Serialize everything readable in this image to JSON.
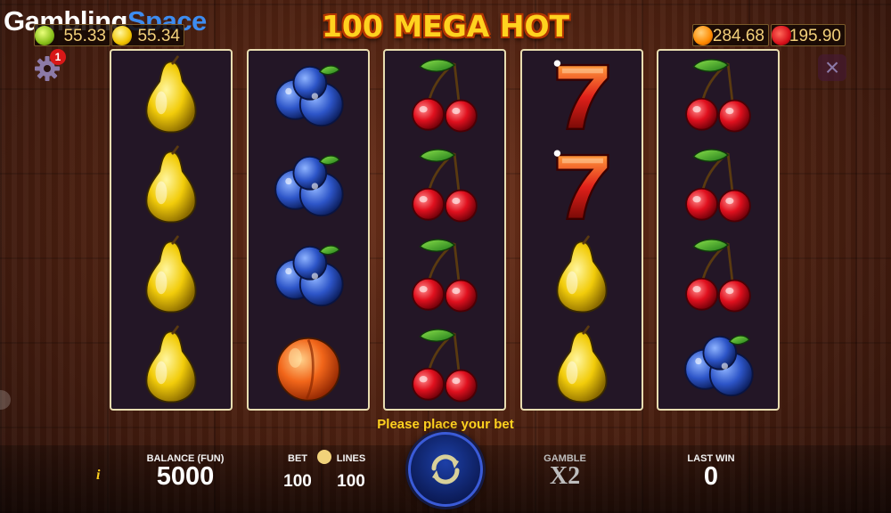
{
  "brand": {
    "word1": "Gambling",
    "word2": "Space"
  },
  "game": {
    "title": "100 MEGA HOT"
  },
  "jackpots": [
    {
      "icon": "lime-icon",
      "value": "55.33"
    },
    {
      "icon": "lemon-icon",
      "value": "55.34"
    },
    {
      "icon": "orange-icon",
      "value": "284.68"
    },
    {
      "icon": "strawberry-icon",
      "value": "195.90"
    }
  ],
  "settings": {
    "notification_count": "1"
  },
  "reels": [
    [
      "pear",
      "pear",
      "pear",
      "pear"
    ],
    [
      "blueberry",
      "blueberry",
      "blueberry",
      "peach"
    ],
    [
      "cherry",
      "cherry",
      "cherry",
      "cherry"
    ],
    [
      "seven",
      "seven",
      "pear",
      "pear"
    ],
    [
      "cherry",
      "cherry",
      "cherry",
      "blueberry"
    ]
  ],
  "status": {
    "prompt": "Please place your bet"
  },
  "controls": {
    "info_label": "i",
    "balance_label": "BALANCE (FUN)",
    "balance_value": "5000",
    "bet_label": "BET",
    "bet_value": "100",
    "lines_label": "LINES",
    "lines_value": "100",
    "gamble_label": "GAMBLE",
    "gamble_value": "X2",
    "last_win_label": "LAST WIN",
    "last_win_value": "0"
  },
  "colors": {
    "title": "#ffd21f",
    "prompt": "#ffd21f",
    "brand_accent": "#3d8cf0",
    "reel_border": "#e8ddb0",
    "reel_bg": "#231626",
    "spin_button": "#1d40a8"
  }
}
